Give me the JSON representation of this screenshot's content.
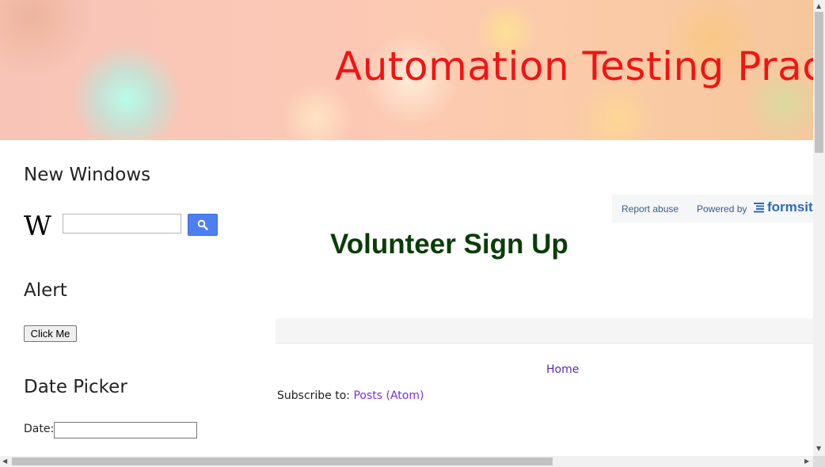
{
  "header": {
    "title": "Automation Testing Practi"
  },
  "sidebar": {
    "new_windows": {
      "title": "New Windows",
      "wiki_logo": "W"
    },
    "alert": {
      "title": "Alert",
      "button_label": "Click Me"
    },
    "date_picker": {
      "title": "Date Picker",
      "date_label": "Date:"
    }
  },
  "form_bar": {
    "report_abuse": "Report abuse",
    "powered_by": "Powered by",
    "logo_text": "formsit"
  },
  "main": {
    "heading": "Volunteer Sign Up",
    "home_link": "Home",
    "subscribe_label": "Subscribe to: ",
    "subscribe_link": "Posts (Atom)"
  },
  "colors": {
    "title_red": "#f31313",
    "heading_green": "#0a3d08",
    "search_blue": "#4d7ff1",
    "link_purple": "#7a2fe0"
  },
  "icons": {
    "search": "search-icon",
    "formsite": "formsite-lines-icon"
  }
}
